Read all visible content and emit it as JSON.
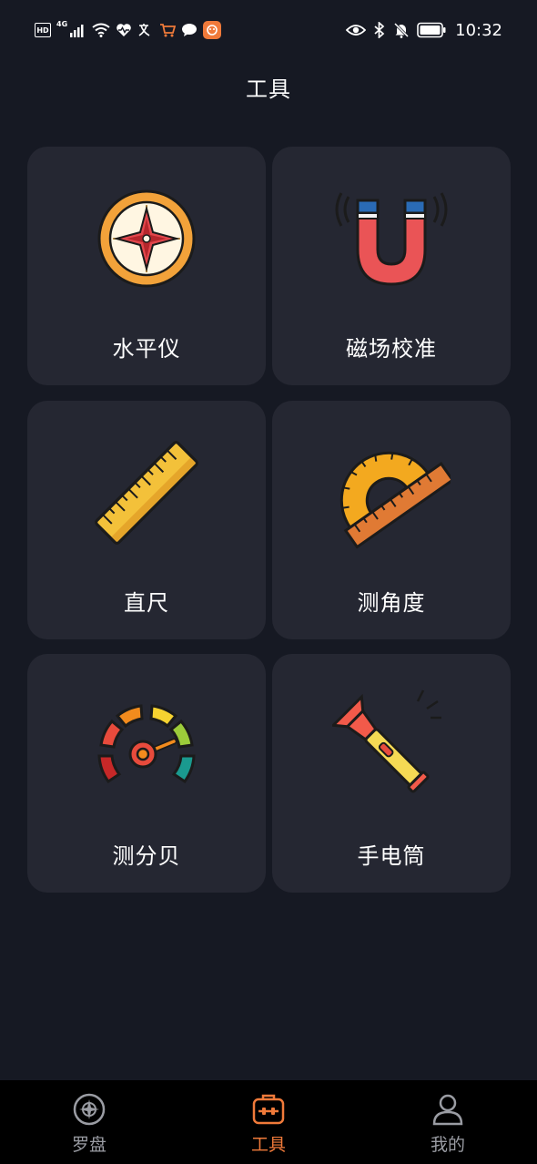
{
  "status_bar": {
    "network_badge": "HD",
    "network_type": "4G",
    "time": "10:32"
  },
  "header": {
    "title": "工具"
  },
  "tools": [
    {
      "label": "水平仪",
      "icon": "compass-icon"
    },
    {
      "label": "磁场校准",
      "icon": "magnet-icon"
    },
    {
      "label": "直尺",
      "icon": "ruler-icon"
    },
    {
      "label": "测角度",
      "icon": "protractor-icon"
    },
    {
      "label": "测分贝",
      "icon": "gauge-icon"
    },
    {
      "label": "手电筒",
      "icon": "flashlight-icon"
    }
  ],
  "tab_bar": {
    "tabs": [
      {
        "label": "罗盘",
        "icon": "compass-tab-icon",
        "active": false
      },
      {
        "label": "工具",
        "icon": "toolbox-tab-icon",
        "active": true
      },
      {
        "label": "我的",
        "icon": "user-tab-icon",
        "active": false
      }
    ]
  },
  "colors": {
    "background": "#161923",
    "card": "#252732",
    "accent": "#f07a3a",
    "tab_inactive": "#9a9ca3",
    "tab_bar": "#000000"
  }
}
